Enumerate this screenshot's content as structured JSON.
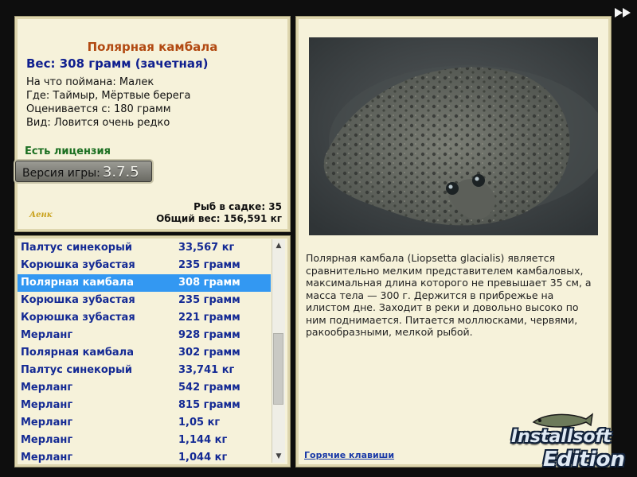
{
  "info": {
    "title": "Полярная камбала",
    "weight": "Вес: 308 грамм (зачетная)",
    "caught_with": "На что поймана: Малек",
    "location": "Где: Таймыр, Мёртвые берега",
    "rated_from": "Оценивается с: 180 грамм",
    "rarity": "Вид: Ловится очень редко",
    "license": "Есть лицензия",
    "version_label": "Версия игры:",
    "version_number": "3.7.5",
    "fish_in_net": "Рыб в садке: 35",
    "total_weight": "Общий вес: 156,591 кг",
    "logo": "Аенк"
  },
  "list": [
    {
      "name": "Палтус синекорый",
      "weight": "33,567 кг"
    },
    {
      "name": "Корюшка зубастая",
      "weight": "235 грамм"
    },
    {
      "name": "Полярная камбала",
      "weight": "308 грамм",
      "selected": true
    },
    {
      "name": "Корюшка зубастая",
      "weight": "235 грамм"
    },
    {
      "name": "Корюшка зубастая",
      "weight": "221 грамм"
    },
    {
      "name": "Мерланг",
      "weight": "928 грамм"
    },
    {
      "name": "Полярная камбала",
      "weight": "302 грамм"
    },
    {
      "name": "Палтус синекорый",
      "weight": "33,741 кг"
    },
    {
      "name": "Мерланг",
      "weight": "542 грамм"
    },
    {
      "name": "Мерланг",
      "weight": "815 грамм"
    },
    {
      "name": "Мерланг",
      "weight": "1,05 кг"
    },
    {
      "name": "Мерланг",
      "weight": "1,144 кг"
    },
    {
      "name": "Мерланг",
      "weight": "1,044 кг"
    }
  ],
  "detail": {
    "description": "Полярная камбала (Liopsetta glacialis) является сравнительно мелким представителем камбаловых, максимальная длина которого не превышает 35 см, а масса тела — 300 г. Держится в прибрежье на илистом дне. Заходит в реки и довольно высоко по ним поднимается. Питается моллюсками, червями, ракообразными, мелкой рыбой.",
    "hotkeys": "Горячие клавиши"
  },
  "badge": {
    "line1": "Installsoft",
    "line2": "Edition"
  },
  "colors": {
    "selected_row": "#3398f2",
    "list_text": "#142a94",
    "title": "#b24a12",
    "license": "#1b6f21"
  },
  "icons": {
    "forward": "fast-forward-icon",
    "scroll_up": "chevron-up-icon",
    "scroll_down": "chevron-down-icon"
  }
}
